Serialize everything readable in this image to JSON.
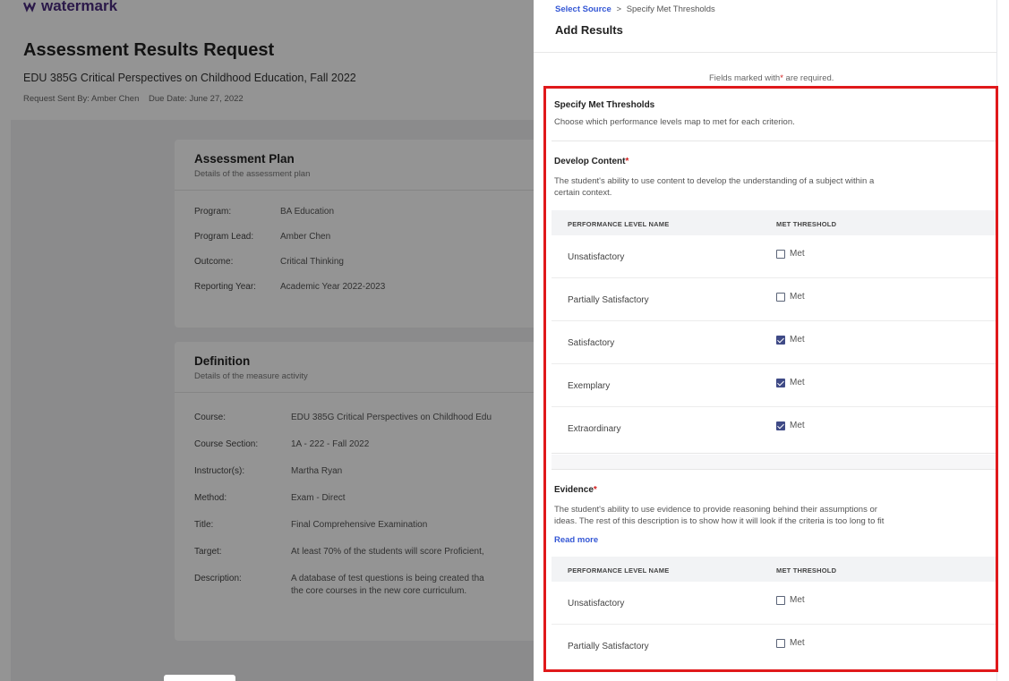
{
  "background": {
    "logo": "watermark",
    "request_title": "Assessment Results Request",
    "course_line": "EDU 385G Critical Perspectives on Childhood Education, Fall 2022",
    "sent_by": "Request Sent By: Amber Chen",
    "due_date": "Due Date: June 27, 2022",
    "plan_card": {
      "title": "Assessment Plan",
      "subtitle": "Details of the assessment plan",
      "fields": [
        {
          "key": "Program:",
          "value": "BA Education"
        },
        {
          "key": "Program Lead:",
          "value": "Amber Chen"
        },
        {
          "key": "Outcome:",
          "value": "Critical Thinking"
        },
        {
          "key": "Reporting Year:",
          "value": "Academic Year 2022-2023"
        }
      ]
    },
    "definition_card": {
      "title": "Definition",
      "subtitle": "Details of the measure activity",
      "fields": [
        {
          "key": "Course:",
          "value": "EDU 385G Critical Perspectives on Childhood Edu"
        },
        {
          "key": "Course Section:",
          "value": "1A - 222 - Fall 2022"
        },
        {
          "key": "Instructor(s):",
          "value": "Martha Ryan"
        },
        {
          "key": "Method:",
          "value": "Exam - Direct"
        },
        {
          "key": "Title:",
          "value": "Final Comprehensive Examination"
        },
        {
          "key": "Target:",
          "value": "At least 70% of the students will score Proficient,"
        },
        {
          "key": "Description:",
          "value": "A database of test questions is being created tha"
        },
        {
          "key": "",
          "value": "the core courses in the new core curriculum."
        }
      ]
    }
  },
  "panel": {
    "breadcrumb_link": "Select Source",
    "breadcrumb_sep": ">",
    "breadcrumb_current": "Specify Met Thresholds",
    "title": "Add Results",
    "required_note_pre": "Fields marked with",
    "required_star": "*",
    "required_note_post": "are required.",
    "section": {
      "title": "Specify Met Thresholds",
      "description": "Choose which performance levels map to met for each criterion."
    },
    "criteria": [
      {
        "name": "Develop Content",
        "description_1": "The student's ability to use content to develop the understanding of a subject within a",
        "description_2": "certain context.",
        "col_name": "PERFORMANCE LEVEL NAME",
        "col_met": "MET THRESHOLD",
        "levels": [
          {
            "name": "Unsatisfactory",
            "met_label": "Met",
            "checked": false
          },
          {
            "name": "Partially Satisfactory",
            "met_label": "Met",
            "checked": false
          },
          {
            "name": "Satisfactory",
            "met_label": "Met",
            "checked": true
          },
          {
            "name": "Exemplary",
            "met_label": "Met",
            "checked": true
          },
          {
            "name": "Extraordinary",
            "met_label": "Met",
            "checked": true
          }
        ]
      },
      {
        "name": "Evidence",
        "description_1": "The student's ability to use evidence to provide reasoning behind their assumptions or",
        "description_2": "ideas. The rest of this description is to show how it will look if the criteria is too long to fit",
        "read_more": "Read more",
        "col_name": "PERFORMANCE LEVEL NAME",
        "col_met": "MET THRESHOLD",
        "levels": [
          {
            "name": "Unsatisfactory",
            "met_label": "Met",
            "checked": false
          },
          {
            "name": "Partially Satisfactory",
            "met_label": "Met",
            "checked": false
          }
        ]
      }
    ]
  },
  "colors": {
    "highlight": "#e0191b",
    "link": "#3457d5",
    "checkbox_checked": "#3f4a86",
    "required": "#d32020"
  }
}
